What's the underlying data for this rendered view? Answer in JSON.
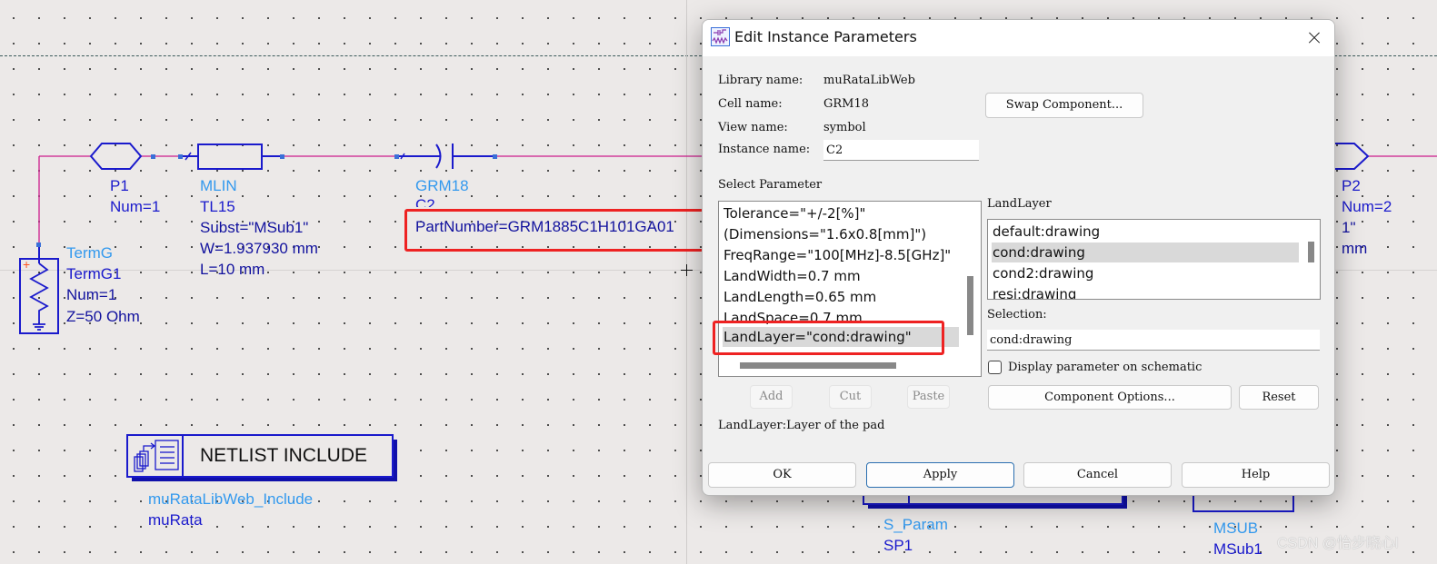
{
  "schematic": {
    "p1": {
      "name": "P1",
      "params": [
        "Num=1"
      ]
    },
    "mlin": {
      "type": "MLIN",
      "name": "TL15",
      "params": [
        "Subst=\"MSub1\"",
        "W=1.937930 mm",
        "L=10 mm"
      ]
    },
    "grm": {
      "type": "GRM18",
      "name": "C2",
      "params": [
        "PartNumber=GRM1885C1H101GA01"
      ]
    },
    "termg": {
      "type": "TermG",
      "name": "TermG1",
      "params": [
        "Num=1",
        "Z=50 Ohm"
      ]
    },
    "p2": {
      "name": "P2",
      "params": [
        "Num=2",
        "1\"",
        "mm"
      ]
    },
    "netlist": {
      "label": "NETLIST INCLUDE",
      "type": "muRataLibWeb_Include",
      "name": "muRata"
    },
    "sparam": {
      "type": "S_Param",
      "name": "SP1"
    },
    "msub": {
      "type": "MSUB",
      "name": "MSub1"
    },
    "watermark": "CSDN @怡步晓心l",
    "colors": {
      "wire": "#cc1d8c",
      "symbol": "#1a1acc",
      "type_label": "#3399ee",
      "highlight": "#ee2222"
    }
  },
  "dialog": {
    "title": "Edit Instance Parameters",
    "library_label": "Library name:",
    "library_value": "muRataLibWeb",
    "cell_label": "Cell name:",
    "cell_value": "GRM18",
    "view_label": "View name:",
    "view_value": "symbol",
    "instance_label": "Instance name:",
    "instance_value": "C2",
    "swap_button": "Swap Component...",
    "select_parameter_label": "Select Parameter",
    "parameters": [
      "Tolerance=\"+/-2[%]\"",
      "(Dimensions=\"1.6x0.8[mm]\")",
      "FreqRange=\"100[MHz]-8.5[GHz]\"",
      "LandWidth=0.7 mm",
      "LandLength=0.65 mm",
      "LandSpace=0.7 mm",
      "LandLayer=\"cond:drawing\""
    ],
    "selected_parameter_index": 6,
    "value_list_label": "LandLayer",
    "value_options": [
      "default:drawing",
      "cond:drawing",
      "cond2:drawing",
      "resi:drawing"
    ],
    "selected_value_index": 1,
    "selection_label": "Selection:",
    "selection_value": "cond:drawing",
    "display_checkbox_label": "Display parameter on schematic",
    "display_checkbox_checked": false,
    "add_button": "Add",
    "cut_button": "Cut",
    "paste_button": "Paste",
    "component_options_button": "Component Options...",
    "reset_button": "Reset",
    "description": "LandLayer:Layer of the pad",
    "ok_button": "OK",
    "apply_button": "Apply",
    "cancel_button": "Cancel",
    "help_button": "Help"
  }
}
